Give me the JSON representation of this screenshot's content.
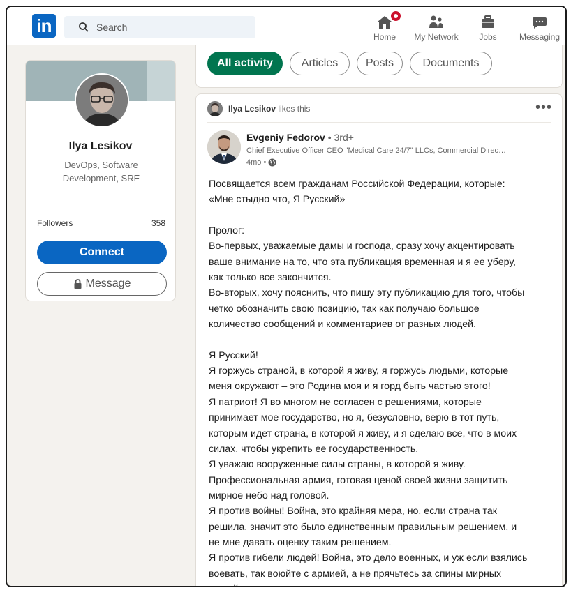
{
  "nav": {
    "logo_text": "in",
    "search_placeholder": "Search",
    "items": [
      {
        "label": "Home",
        "icon": "home-icon"
      },
      {
        "label": "My Network",
        "icon": "network-icon"
      },
      {
        "label": "Jobs",
        "icon": "briefcase-icon"
      },
      {
        "label": "Messaging",
        "icon": "messaging-icon"
      }
    ]
  },
  "profile": {
    "name": "Ilya Lesikov",
    "headline": "DevOps, Software Development, SRE",
    "followers_label": "Followers",
    "followers_count": "358",
    "connect_label": "Connect",
    "message_label": "Message"
  },
  "filters": [
    {
      "label": "All activity",
      "active": true
    },
    {
      "label": "Articles",
      "active": false
    },
    {
      "label": "Posts",
      "active": false
    },
    {
      "label": "Documents",
      "active": false
    }
  ],
  "post": {
    "activity_actor": "Ilya Lesikov",
    "activity_action": "likes this",
    "more_label": "•••",
    "author_name": "Evgeniy Fedorov",
    "author_degree": "• 3rd+",
    "author_headline": "Chief Executive Officer CEO \"Medical Care 24/7\" LLCs, Commercial Direc…",
    "time_label": "4mo •",
    "body_lines": [
      "Посвящается всем гражданам Российской Федерации, которые:",
      "«Мне стыдно что, Я Русский»",
      "",
      "Пролог:",
      "Во-первых, уважаемые дамы и господа, сразу хочу акцентировать",
      "ваше внимание на то, что эта публикация временная и я ее уберу,",
      "как только все закончится.",
      "Во-вторых, хочу пояснить, что пишу эту публикацию для того, чтобы",
      "четко обозначить свою позицию, так как получаю большое",
      "количество сообщений и комментариев от разных людей.",
      "",
      "Я Русский!",
      "Я горжусь страной, в которой я живу, я горжусь людьми, которые",
      "меня окружают – это Родина моя и я горд быть частью этого!",
      "Я патриот! Я во многом не согласен с решениями, которые",
      "принимает мое государство, но я, безусловно, верю в тот путь,",
      "которым идет страна, в которой я живу, и я сделаю все, что в моих",
      "силах, чтобы укрепить ее государственность.",
      "Я уважаю вооруженные силы страны, в которой я живу.",
      "Профессиональная армия, готовая ценой своей жизни защитить",
      "мирное небо над головой.",
      "Я против войны! Война, это крайняя мера, но, если страна так",
      "решила, значит это было единственным правильным решением, и",
      "не мне давать оценку таким решением.",
      "Я против гибели людей! Война, это дело военных, и уж если взялись",
      "воевать, так воюйте с армией, а не прячьтесь за спины мирных",
      "людей, которых вы должны защищать."
    ]
  },
  "colors": {
    "brand": "#0a66c2",
    "active_filter": "#01754f",
    "notification": "#cb112d"
  }
}
